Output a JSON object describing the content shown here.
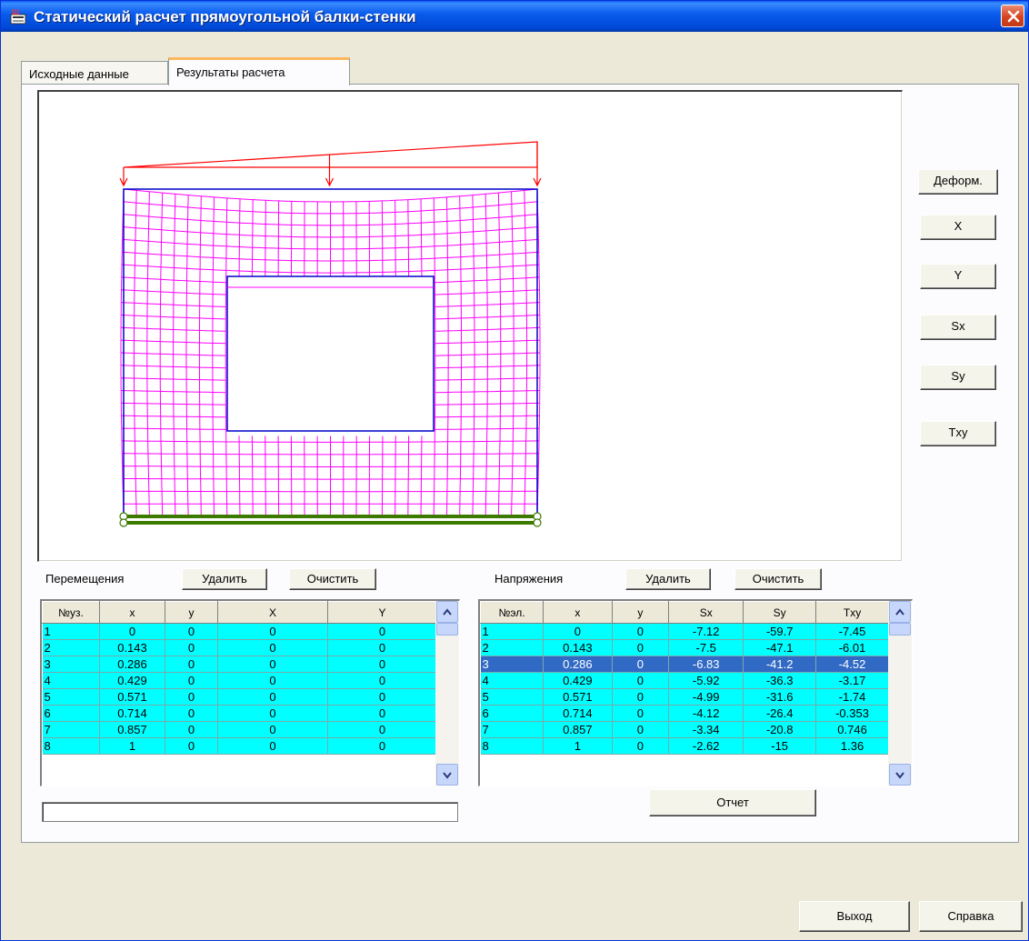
{
  "window": {
    "title": "Статический расчет прямоугольной балки-стенки",
    "accent": "#0047d6"
  },
  "tabs": [
    {
      "label": "Исходные данные",
      "active": false
    },
    {
      "label": "Результаты расчета",
      "active": true
    }
  ],
  "view_buttons": {
    "deform": "Деформ.",
    "x": "X",
    "y": "Y",
    "sx": "Sx",
    "sy": "Sy",
    "txy": "Txy"
  },
  "displacements": {
    "title": "Перемещения",
    "delete_label": "Удалить",
    "clear_label": "Очистить",
    "columns": [
      "№уз.",
      "x",
      "y",
      "X",
      "Y"
    ],
    "rows": [
      [
        "1",
        "0",
        "0",
        "0",
        "0"
      ],
      [
        "2",
        "0.143",
        "0",
        "0",
        "0"
      ],
      [
        "3",
        "0.286",
        "0",
        "0",
        "0"
      ],
      [
        "4",
        "0.429",
        "0",
        "0",
        "0"
      ],
      [
        "5",
        "0.571",
        "0",
        "0",
        "0"
      ],
      [
        "6",
        "0.714",
        "0",
        "0",
        "0"
      ],
      [
        "7",
        "0.857",
        "0",
        "0",
        "0"
      ],
      [
        "8",
        "1",
        "0",
        "0",
        "0"
      ]
    ],
    "progress": 0
  },
  "stresses": {
    "title": "Напряжения",
    "delete_label": "Удалить",
    "clear_label": "Очистить",
    "columns": [
      "№эл.",
      "x",
      "y",
      "Sx",
      "Sy",
      "Txy"
    ],
    "rows": [
      [
        "1",
        "0",
        "0",
        "-7.12",
        "-59.7",
        "-7.45"
      ],
      [
        "2",
        "0.143",
        "0",
        "-7.5",
        "-47.1",
        "-6.01"
      ],
      [
        "3",
        "0.286",
        "0",
        "-6.83",
        "-41.2",
        "-4.52"
      ],
      [
        "4",
        "0.429",
        "0",
        "-5.92",
        "-36.3",
        "-3.17"
      ],
      [
        "5",
        "0.571",
        "0",
        "-4.99",
        "-31.6",
        "-1.74"
      ],
      [
        "6",
        "0.714",
        "0",
        "-4.12",
        "-26.4",
        "-0.353"
      ],
      [
        "7",
        "0.857",
        "0",
        "-3.34",
        "-20.8",
        "0.746"
      ],
      [
        "8",
        "1",
        "0",
        "-2.62",
        "-15",
        "1.36"
      ]
    ],
    "selected_row": 3,
    "report_label": "Отчет"
  },
  "footer": {
    "exit_label": "Выход",
    "help_label": "Справка"
  },
  "colors": {
    "mesh": "#ff00ff",
    "contour": "#0000cc",
    "load": "#ff0000",
    "support": "#3c7a00",
    "table_cell": "#00ffff",
    "selection": "#316ac5"
  },
  "icons": {
    "app": "app-icon",
    "close": "close-icon",
    "scroll_up": "scroll-up-icon",
    "scroll_down": "scroll-down-icon"
  }
}
